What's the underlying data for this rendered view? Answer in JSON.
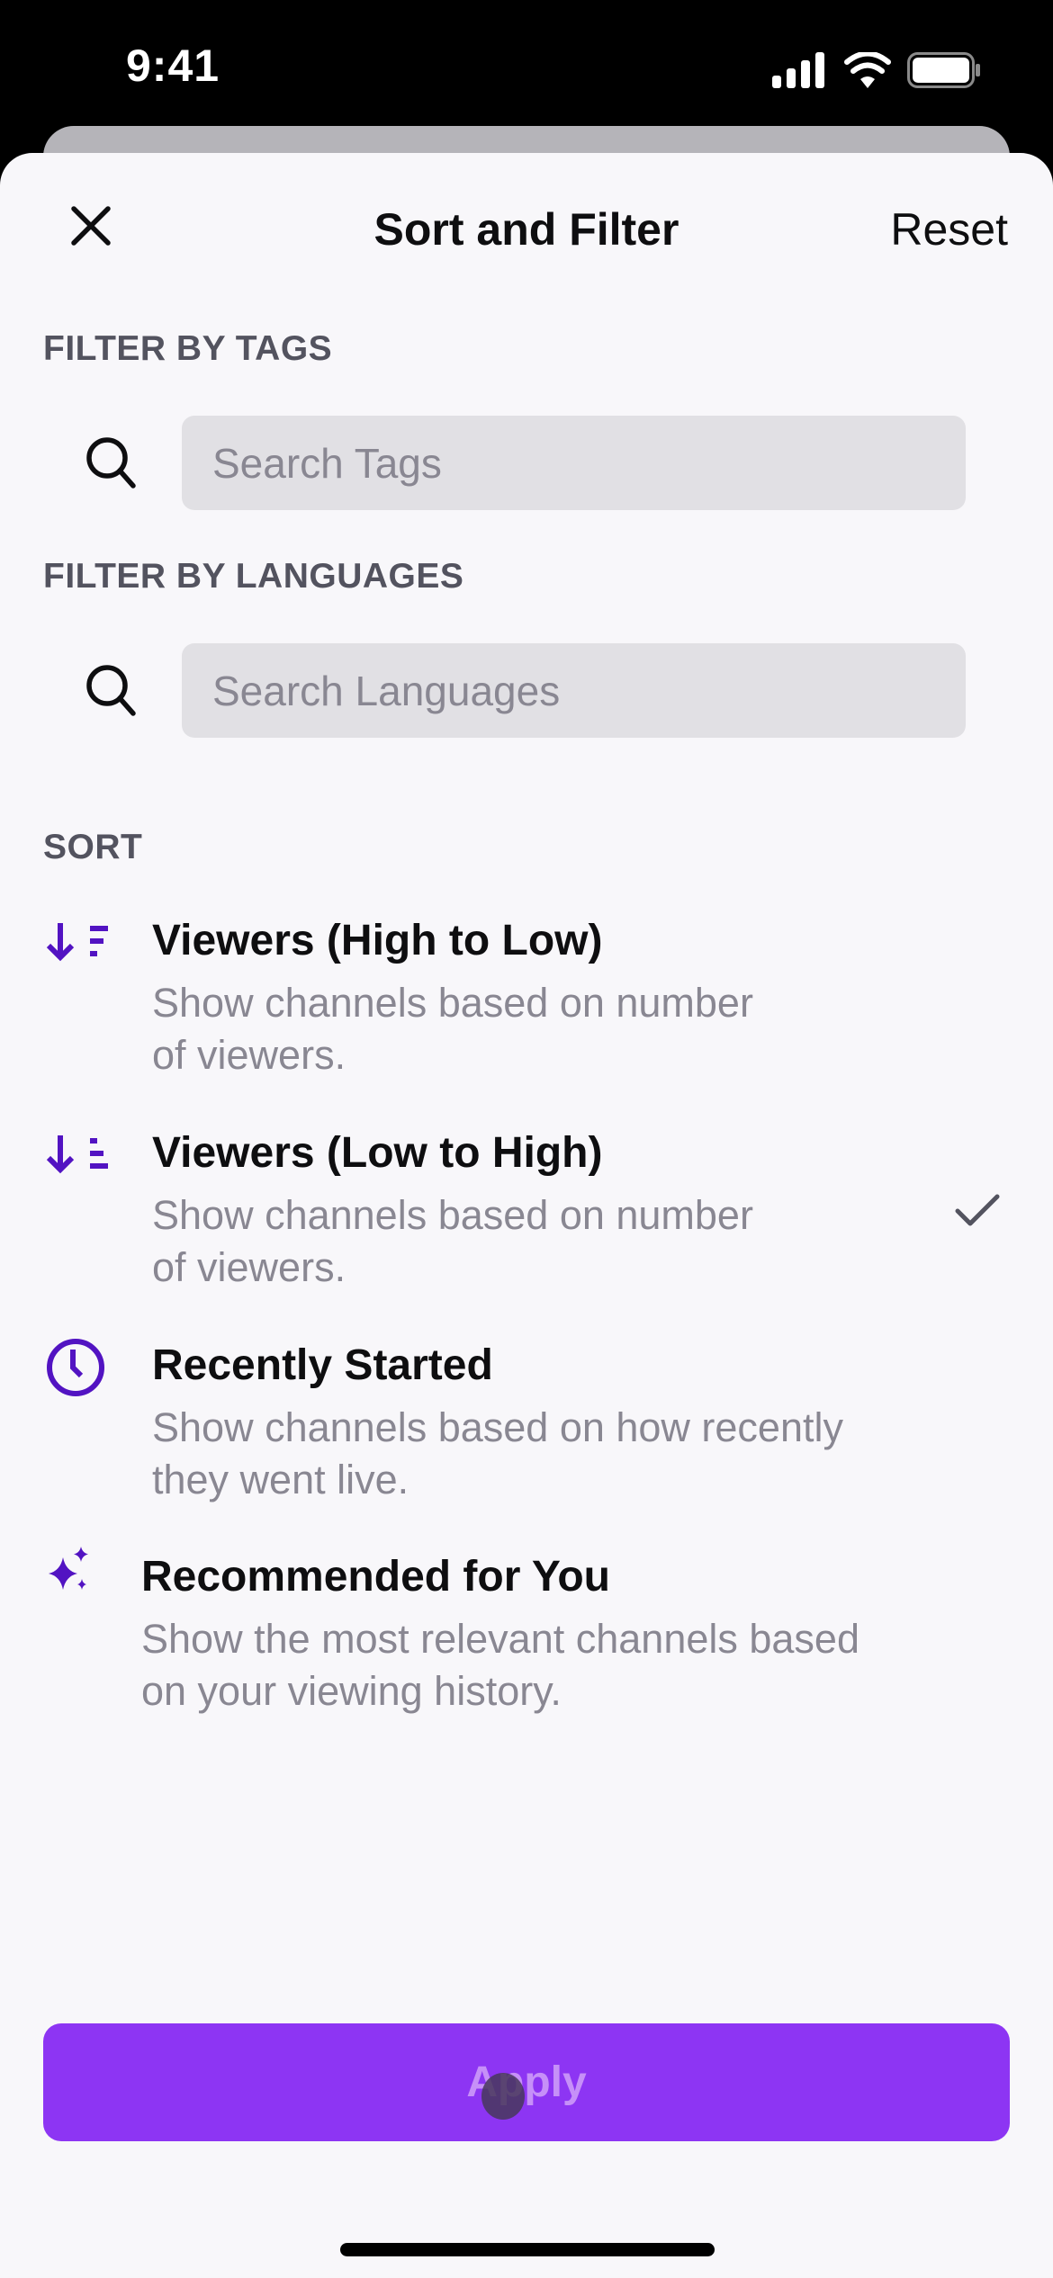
{
  "status_bar": {
    "time": "9:41",
    "icons": [
      "cellular-signal-icon",
      "wifi-icon",
      "battery-icon"
    ]
  },
  "header": {
    "title": "Sort and Filter",
    "close_icon": "close-icon",
    "reset_label": "Reset"
  },
  "filters": {
    "tags": {
      "label": "FILTER BY TAGS",
      "placeholder": "Search Tags",
      "value": ""
    },
    "languages": {
      "label": "FILTER BY LANGUAGES",
      "placeholder": "Search Languages",
      "value": ""
    }
  },
  "sort": {
    "label": "SORT",
    "items": [
      {
        "icon": "sort-descending-icon",
        "title": "Viewers (High to Low)",
        "desc_line1": "Show channels based on number",
        "desc_line2": "of viewers.",
        "selected": false
      },
      {
        "icon": "sort-ascending-icon",
        "title": "Viewers (Low to High)",
        "desc_line1": "Show channels based on number",
        "desc_line2": "of viewers.",
        "selected": true
      },
      {
        "icon": "clock-icon",
        "title": "Recently Started",
        "desc_line1": "Show channels based on how recently",
        "desc_line2": "they went live.",
        "selected": false
      },
      {
        "icon": "sparkle-icon",
        "title": "Recommended for You",
        "desc_line1": "Show the most relevant channels based",
        "desc_line2": "on your viewing history.",
        "selected": false
      }
    ]
  },
  "footer": {
    "apply_label": "Apply"
  },
  "colors": {
    "accent": "#8d35f3",
    "icon_purple": "#5213c2",
    "sheet_bg": "#f8f7fa",
    "secondary_text": "#898792"
  }
}
